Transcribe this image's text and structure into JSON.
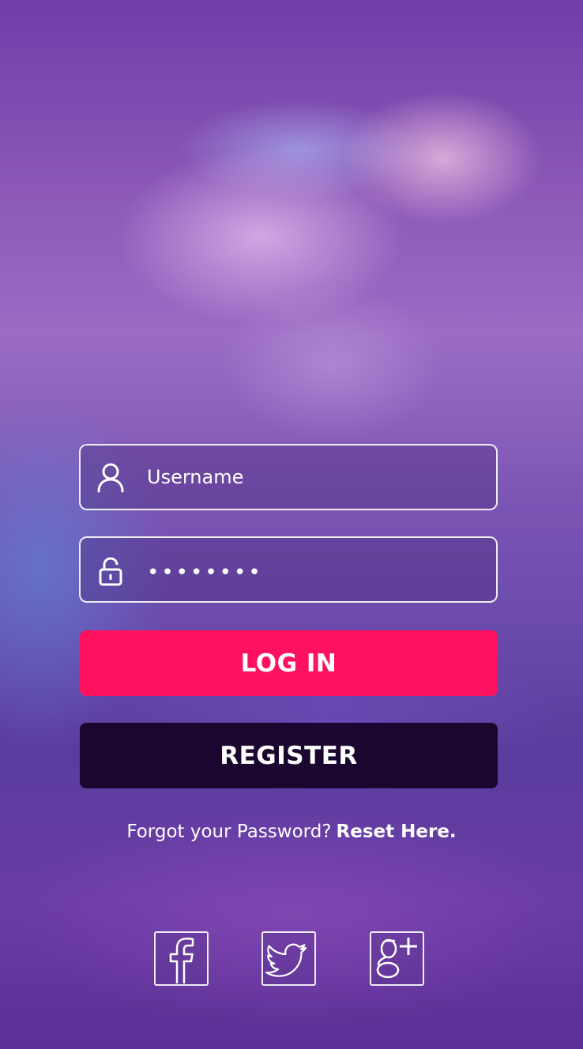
{
  "login_form": {
    "username": {
      "placeholder": "Username",
      "value": "",
      "icon": "user-icon"
    },
    "password": {
      "value": "••••••••",
      "icon": "lock-icon"
    },
    "login_label": "LOG IN",
    "register_label": "REGISTER",
    "forgot_text": "Forgot your Password?",
    "reset_link": "Reset Here."
  },
  "social": [
    {
      "name": "facebook",
      "icon": "facebook-icon"
    },
    {
      "name": "twitter",
      "icon": "twitter-icon"
    },
    {
      "name": "google-plus",
      "icon": "google-plus-icon"
    }
  ],
  "colors": {
    "login_button": "#fe1260",
    "register_button": "#1b0630",
    "text": "#ffffff"
  }
}
